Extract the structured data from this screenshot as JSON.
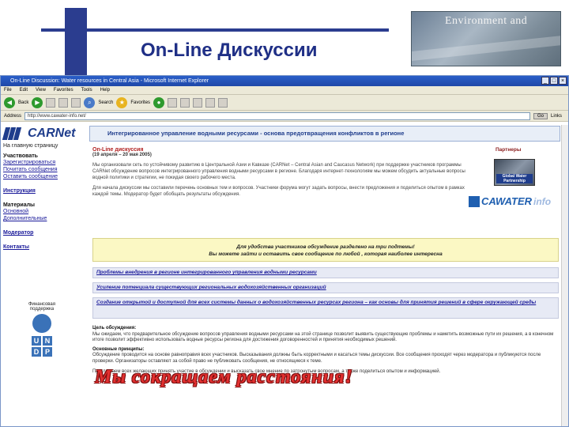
{
  "slide": {
    "title": "On-Line Дискуссии",
    "env_banner": "Environment and",
    "overlay_text": "Мы сокращаем расстояния!"
  },
  "browser": {
    "title": "On-Line Discussion: Water resources in Central Asia - Microsoft Internet Explorer",
    "menu": [
      "File",
      "Edit",
      "View",
      "Favorites",
      "Tools",
      "Help"
    ],
    "toolbar": {
      "back": "Back",
      "search": "Search",
      "favorites": "Favorites"
    },
    "address_label": "Address",
    "address_value": "http://www.cawater-info.net/",
    "go_label": "Go",
    "links_label": "Links"
  },
  "page": {
    "logo": "CARNet",
    "banner": "Интегрированное управление водными ресурсами - основа предотвращения конфликтов в регионе",
    "sidebar": {
      "home": "На главную страницу",
      "participate_title": "Участвовать",
      "participate_links": [
        "Зарегистрироваться",
        "Почитать сообщения",
        "Оставить сообщение"
      ],
      "instruction": "Инструкция",
      "materials_title": "Материалы",
      "materials_links": [
        "Основной",
        "Дополнительные"
      ],
      "moderator": "Модератор",
      "contacts": "Контакты",
      "undp_caption": "Финансовая поддержка",
      "undp_letters": [
        "U",
        "N",
        "D",
        "P"
      ]
    },
    "main": {
      "heading": "On-Line дискуссия",
      "dates": "(19 апреля – 20 мая 2005)",
      "intro_1": "Мы организовали сеть по устойчивому развитию в Центральной Азии и Кавказе (CARNet – Central Asian and Caucasus Network) при поддержке участников программы CARNet обсуждение вопросов интегрированного управления водными ресурсами в регионе. Благодаря интернет-технологиям мы можем обсудить актуальные вопросы водной политики и стратегии, не покидая своего рабочего места.",
      "intro_2": "Для начала дискуссии мы составили перечень основных тем и вопросов. Участники форума могут задать вопросы, внести предложения и поделиться опытом в рамках каждой темы. Модератор будет обобщать результаты обсуждения."
    },
    "partners": {
      "title": "Партнеры",
      "img_caption": "Global Water Partnership",
      "cawater": "CAWATER",
      "cawater_suffix": "info"
    },
    "notice": {
      "line1": "Для удобства участников обсуждение разделено на три подтемы!",
      "line2": "Вы можете зайти и оставить свое сообщение по любой , которая наиболее интересна"
    },
    "topics": [
      "Проблемы внедрения в регионе интегрированного управления водными ресурсами",
      "Усиление потенциала существующих региональных водохозяйственных организаций",
      "Создание открытой и доступной для всех системы данных о водохозяйственных ресурсах региона – как основы для принятия решений в сфере окружающей среды"
    ],
    "body": {
      "goal_title": "Цель обсуждения:",
      "goal_text": "Мы ожидаем, что предварительное обсуждение вопросов управления водными ресурсами на этой странице позволит выявить существующие проблемы и наметить возможные пути их решения, а в конечном итоге позволит эффективно использовать водные ресурсы региона для достижения договоренностей и принятия необходимых решений.",
      "principles_title": "Основные принципы:",
      "principles_text": "Обсуждение проводится на основе равноправия всех участников. Высказывания должны быть корректными и касаться темы дискуссии. Все сообщения проходят через модератора и публикуются после проверки. Организаторы оставляют за собой право не публиковать сообщения, не относящиеся к теме.",
      "closing_text": "Приглашаем всех желающих принять участие в обсуждении и высказать свое мнение по затронутым вопросам, а также поделиться опытом и информацией."
    }
  }
}
